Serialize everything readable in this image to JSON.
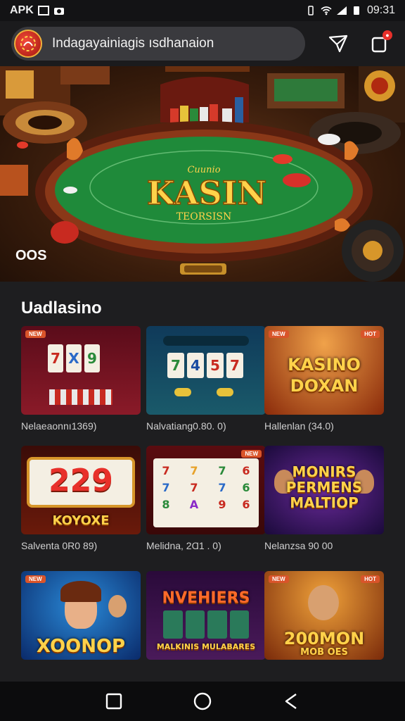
{
  "status_bar": {
    "left_text": "APK",
    "time": "09:31"
  },
  "search": {
    "text": "Indagayainiagis ısdhanaion"
  },
  "hero": {
    "logo_small": "Cuunio",
    "title": "KASIN",
    "subtitle": "TEORSISN",
    "caption": "OOS"
  },
  "section": {
    "title": "Uadlasino"
  },
  "games": [
    {
      "label": "Nelaeaonnı1369)",
      "thumb_text": "7 X 9",
      "tag": "",
      "style": "reels-red"
    },
    {
      "label": "Nalvatiang0.80. 0)",
      "thumb_text": "7 4 5 7",
      "tag": "",
      "style": "reels-teal"
    },
    {
      "label": "Hallenlan (34.0)",
      "thumb_text": "KASINO DOXAN",
      "tag": "",
      "style": "brand-orange"
    },
    {
      "label": "Salventa 0R0 89)",
      "thumb_text": "229",
      "sub_text": "KOYOXE",
      "tag": "",
      "style": "big-numbers"
    },
    {
      "label": "Melidna, 2Ɑ1 . 0)",
      "thumb_text": "7 7 8",
      "tag": "",
      "style": "reels-white"
    },
    {
      "label": "Nelanzsa 90 00",
      "thumb_text": "MONIRS PERMENS MALTIOP",
      "tag": "",
      "style": "brand-purple"
    },
    {
      "label": "",
      "thumb_text": "XOONOP",
      "tag": "",
      "style": "people-blue"
    },
    {
      "label": "",
      "thumb_text": "NVEHIERS",
      "sub_text": "MALKINIS MULABARES",
      "tag": "",
      "style": "people-purple"
    },
    {
      "label": "",
      "thumb_text": "200MON",
      "sub_text": "MOB OES",
      "tag": "",
      "style": "people-orange"
    }
  ],
  "colors": {
    "background": "#1e1e20",
    "accent_red": "#e8302a",
    "felt_green": "#1f8a3a",
    "gold": "#ffd24a"
  },
  "icons": {
    "logo": "casino-chip-logo",
    "send": "send-icon",
    "notifications": "notification-icon",
    "nav_back": "back-icon",
    "nav_home": "home-icon",
    "nav_recent": "recent-apps-icon"
  }
}
